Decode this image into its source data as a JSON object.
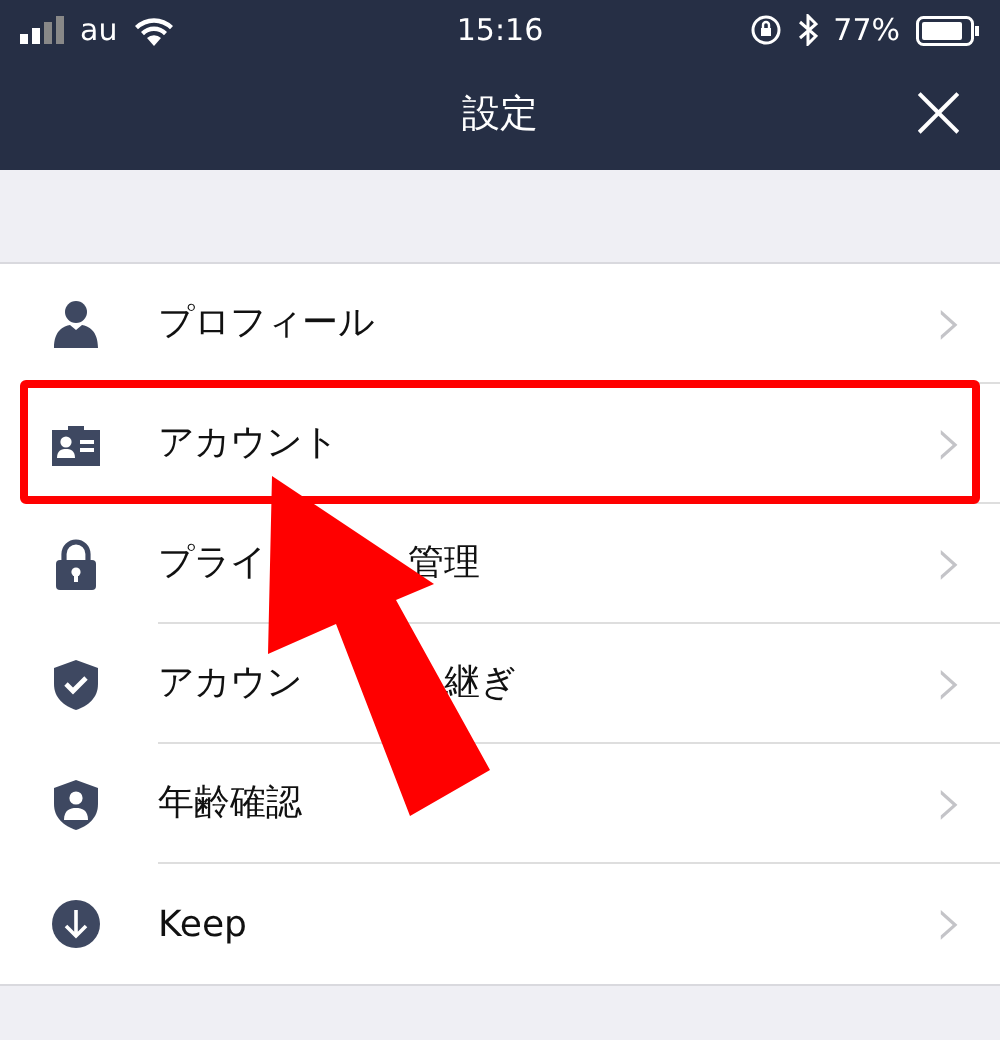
{
  "status_bar": {
    "carrier": "au",
    "time": "15:16",
    "battery": "77%"
  },
  "nav_bar": {
    "title": "設定",
    "close": "×"
  },
  "rows": [
    {
      "label_parts": [
        "プロフィール"
      ],
      "chevron": "›",
      "highlighted": false
    },
    {
      "label_parts": [
        "アカウント"
      ],
      "chevron": "›",
      "highlighted": true
    },
    {
      "label_parts": [
        "プライ",
        "管理"
      ],
      "chevron": "›",
      "highlighted": false
    },
    {
      "label_parts": [
        "アカウン",
        "継ぎ"
      ],
      "chevron": "›",
      "highlighted": false
    },
    {
      "label_parts": [
        "年齢確認"
      ],
      "chevron": "›",
      "highlighted": false
    },
    {
      "label_parts": [
        "Keep"
      ],
      "chevron": "›",
      "highlighted": false
    }
  ]
}
